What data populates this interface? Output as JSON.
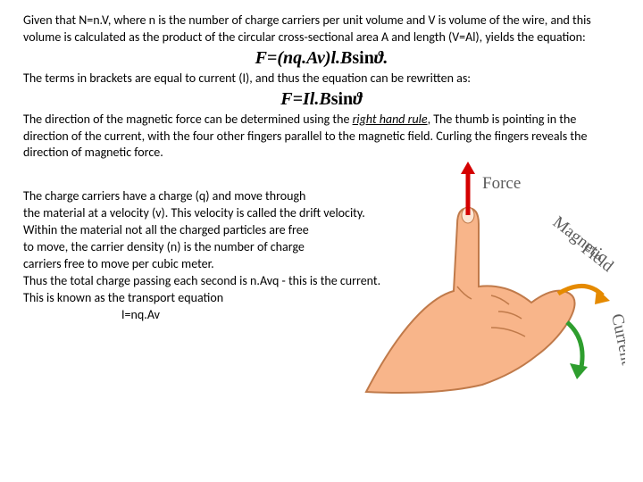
{
  "p1": "Given that N=n.V, where n is the number of charge carriers per unit volume and V is volume of the wire, and  this volume is calculated as the product of the circular cross-sectional area A and length (V=Al), yields the equation:",
  "eq1_a": "F=(nq.Av)l.B",
  "eq1_b": "sin",
  "eq1_c": "ϑ.",
  "p2": "The terms in brackets  are equal to current (I), and thus  the equation can be rewritten as:",
  "eq2_a": "F=Il.B",
  "eq2_b": "sin",
  "eq2_c": "ϑ",
  "p3_a": "The direction of the magnetic force can be determined using the ",
  "p3_rule": "right hand rule",
  "p3_b": ", The thumb is pointing in the direction of the current, with the four other  fingers parallel to the magnetic field. Curling the fingers reveals the direction of magnetic force.",
  "p4_l1": "The charge carriers have a charge (q) and move through",
  "p4_l2": "the material at a velocity (v). This velocity is called the drift velocity.",
  "p4_l3": " Within the material not all the charged particles are free",
  "p4_l4": " to move, the carrier density (n) is the number of charge",
  "p4_l5": "carriers free to move per cubic meter.",
  "p4_l6": "Thus the total charge passing each second is n.Avq - this is the current.",
  "p4_l7": "This is known as the transport equation",
  "eq3": "I=nq.Av",
  "labels": {
    "force": "Force",
    "magnetic": "Magnetic",
    "field": "Field",
    "current": "Current"
  }
}
